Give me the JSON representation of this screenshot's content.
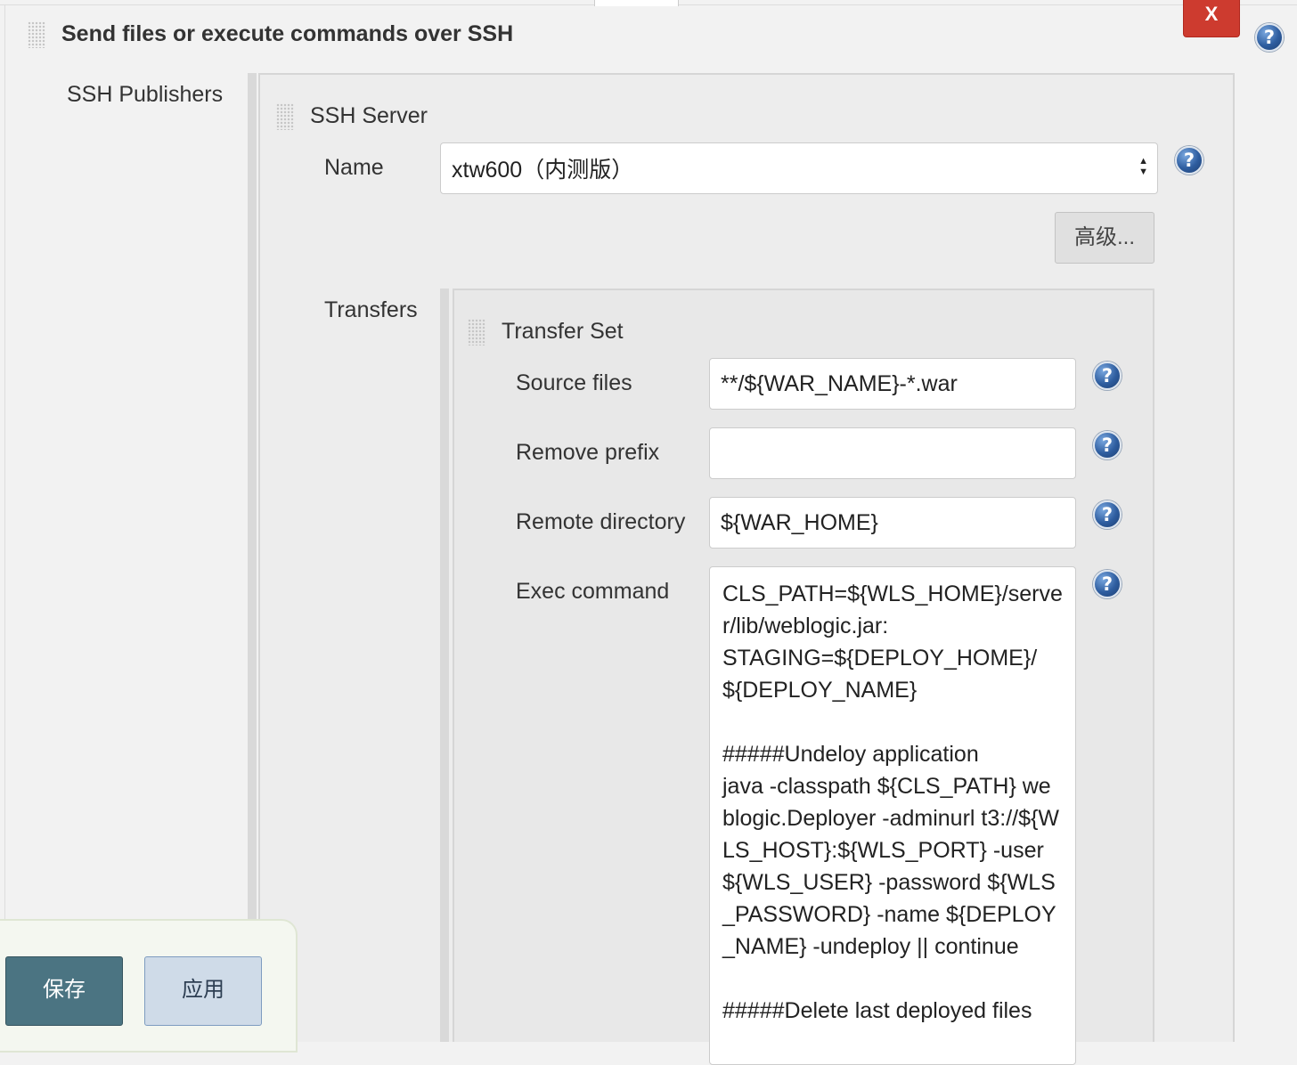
{
  "section": {
    "title": "Send files or execute commands over SSH",
    "close_label": "X",
    "help_glyph": "?"
  },
  "ssh_publishers": {
    "label": "SSH Publishers"
  },
  "ssh_server": {
    "title": "SSH Server",
    "name_label": "Name",
    "name_value": "xtw600（内测版）",
    "advanced_label": "高级..."
  },
  "transfers": {
    "label": "Transfers",
    "set_title": "Transfer Set",
    "source_files_label": "Source files",
    "source_files_value": "**/${WAR_NAME}-*.war",
    "remove_prefix_label": "Remove prefix",
    "remove_prefix_value": "",
    "remote_directory_label": "Remote directory",
    "remote_directory_value": "${WAR_HOME}",
    "exec_command_label": "Exec command",
    "exec_command_value": "CLS_PATH=${WLS_HOME}/server/lib/weblogic.jar:\nSTAGING=${DEPLOY_HOME}/${DEPLOY_NAME}\n\n#####Undeloy application\njava -classpath ${CLS_PATH} weblogic.Deployer -adminurl t3://${WLS_HOST}:${WLS_PORT} -user ${WLS_USER} -password ${WLS_PASSWORD} -name ${DEPLOY_NAME} -undeploy || continue\n\n#####Delete last deployed files"
  },
  "footer": {
    "save_label": "保存",
    "apply_label": "应用"
  },
  "icons": {
    "drag_handle": "drag-handle-icon",
    "help": "help-icon",
    "close": "close-icon",
    "select_arrows": "select-arrows-icon"
  },
  "colors": {
    "close_button": "#cd3b2f",
    "save_button": "#4b7482",
    "apply_button": "#cfdbe8",
    "help_icon": "#2e5d9f"
  }
}
